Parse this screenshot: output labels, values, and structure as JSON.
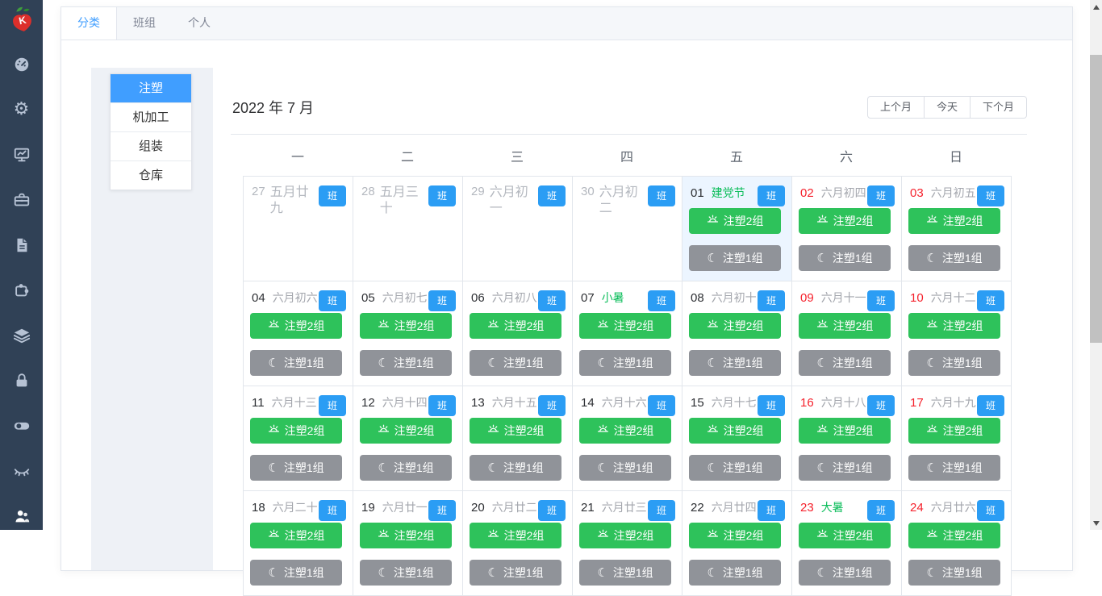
{
  "app": {
    "logo_letter": "K"
  },
  "sidebar": {
    "icons": [
      {
        "name": "dashboard"
      },
      {
        "name": "settings-gear"
      },
      {
        "name": "monitor-chart"
      },
      {
        "name": "toolbox"
      },
      {
        "name": "document"
      },
      {
        "name": "puzzle"
      },
      {
        "name": "layers"
      },
      {
        "name": "lock"
      },
      {
        "name": "toggle"
      },
      {
        "name": "closed-eye"
      },
      {
        "name": "users",
        "active": true
      }
    ]
  },
  "tabs": {
    "items": [
      {
        "label": "分类",
        "active": true
      },
      {
        "label": "班组",
        "active": false
      },
      {
        "label": "个人",
        "active": false
      }
    ]
  },
  "category_menu": {
    "items": [
      {
        "label": "注塑",
        "selected": true
      },
      {
        "label": "机加工",
        "selected": false
      },
      {
        "label": "组装",
        "selected": false
      },
      {
        "label": "仓库",
        "selected": false
      }
    ]
  },
  "calendar": {
    "title": "2022 年 7 月",
    "controls": [
      {
        "label": "上个月"
      },
      {
        "label": "今天"
      },
      {
        "label": "下个月"
      }
    ],
    "weekdays": [
      "一",
      "二",
      "三",
      "四",
      "五",
      "六",
      "日"
    ],
    "badge_label": "班",
    "shifts": {
      "day": "注塑2组",
      "night": "注塑1组"
    },
    "weeks": [
      [
        {
          "num": "27",
          "lunar": "五月廿九",
          "outside": true
        },
        {
          "num": "28",
          "lunar": "五月三十",
          "outside": true
        },
        {
          "num": "29",
          "lunar": "六月初一",
          "outside": true
        },
        {
          "num": "30",
          "lunar": "六月初二",
          "outside": true
        },
        {
          "num": "01",
          "lunar": "建党节",
          "lunar_green": true,
          "today": true,
          "shifts": true
        },
        {
          "num": "02",
          "lunar": "六月初四",
          "weekend": true,
          "shifts": true
        },
        {
          "num": "03",
          "lunar": "六月初五",
          "weekend": true,
          "shifts": true
        }
      ],
      [
        {
          "num": "04",
          "lunar": "六月初六",
          "shifts": true
        },
        {
          "num": "05",
          "lunar": "六月初七",
          "shifts": true
        },
        {
          "num": "06",
          "lunar": "六月初八",
          "shifts": true
        },
        {
          "num": "07",
          "lunar": "小暑",
          "lunar_green": true,
          "shifts": true
        },
        {
          "num": "08",
          "lunar": "六月初十",
          "shifts": true
        },
        {
          "num": "09",
          "lunar": "六月十一",
          "weekend": true,
          "shifts": true
        },
        {
          "num": "10",
          "lunar": "六月十二",
          "weekend": true,
          "shifts": true
        }
      ],
      [
        {
          "num": "11",
          "lunar": "六月十三",
          "shifts": true
        },
        {
          "num": "12",
          "lunar": "六月十四",
          "shifts": true
        },
        {
          "num": "13",
          "lunar": "六月十五",
          "shifts": true
        },
        {
          "num": "14",
          "lunar": "六月十六",
          "shifts": true
        },
        {
          "num": "15",
          "lunar": "六月十七",
          "shifts": true
        },
        {
          "num": "16",
          "lunar": "六月十八",
          "weekend": true,
          "shifts": true
        },
        {
          "num": "17",
          "lunar": "六月十九",
          "weekend": true,
          "shifts": true
        }
      ],
      [
        {
          "num": "18",
          "lunar": "六月二十",
          "shifts": true
        },
        {
          "num": "19",
          "lunar": "六月廿一",
          "shifts": true
        },
        {
          "num": "20",
          "lunar": "六月廿二",
          "shifts": true
        },
        {
          "num": "21",
          "lunar": "六月廿三",
          "shifts": true
        },
        {
          "num": "22",
          "lunar": "六月廿四",
          "shifts": true
        },
        {
          "num": "23",
          "lunar": "大暑",
          "lunar_green": true,
          "weekend": true,
          "shifts": true
        },
        {
          "num": "24",
          "lunar": "六月廿六",
          "weekend": true,
          "shifts": true
        }
      ]
    ]
  },
  "colors": {
    "sidebar_bg": "#304156",
    "sidebar_icon": "#b6c2d4",
    "primary_blue": "#409eff",
    "badge_blue": "#2b9df4",
    "day_shift_green": "#2ec25b",
    "night_shift_gray": "#909399",
    "holiday_green": "#0bbd5a",
    "weekend_red": "#f5222d",
    "today_bg": "#ecf5ff",
    "panel_gray": "#eef1f6"
  }
}
